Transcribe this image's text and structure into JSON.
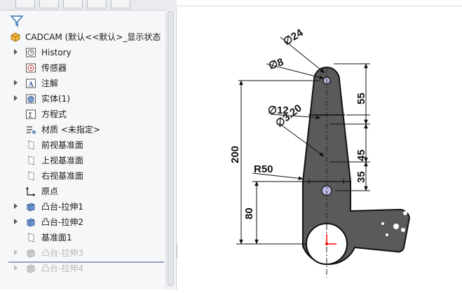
{
  "tree": {
    "root": {
      "label": "CADCAM  (默认<<默认>_显示状态",
      "icon": "part-icon"
    },
    "items": [
      {
        "label": "History",
        "icon": "history-icon",
        "expandable": true,
        "dim": false
      },
      {
        "label": "传感器",
        "icon": "sensor-icon",
        "expandable": false,
        "dim": false
      },
      {
        "label": "注解",
        "icon": "annotation-icon",
        "expandable": true,
        "dim": false
      },
      {
        "label": "实体(1)",
        "icon": "solid-body-icon",
        "expandable": true,
        "dim": false
      },
      {
        "label": "方程式",
        "icon": "equation-icon",
        "expandable": false,
        "dim": false
      },
      {
        "label": "材质 <未指定>",
        "icon": "material-icon",
        "expandable": false,
        "dim": false
      },
      {
        "label": "前视基准面",
        "icon": "plane-icon",
        "expandable": false,
        "dim": false
      },
      {
        "label": "上视基准面",
        "icon": "plane-icon",
        "expandable": false,
        "dim": false
      },
      {
        "label": "右视基准面",
        "icon": "plane-icon",
        "expandable": false,
        "dim": false
      },
      {
        "label": "原点",
        "icon": "origin-icon",
        "expandable": false,
        "dim": false
      },
      {
        "label": "凸台-拉伸1",
        "icon": "extrude-icon",
        "expandable": true,
        "dim": false
      },
      {
        "label": "凸台-拉伸2",
        "icon": "extrude-icon",
        "expandable": true,
        "dim": false
      },
      {
        "label": "基准面1",
        "icon": "plane-icon",
        "expandable": false,
        "dim": false
      },
      {
        "label": "凸台-拉伸3",
        "icon": "extrude-icon",
        "expandable": true,
        "dim": true
      },
      {
        "label": "凸台-拉伸4",
        "icon": "extrude-icon",
        "expandable": true,
        "dim": true
      }
    ]
  },
  "drawing": {
    "dimensions": {
      "d24": "∅24",
      "d8": "∅8",
      "d12": "∅12",
      "d320": "∅3.20",
      "r50": "R50",
      "v200": "200",
      "v80": "80",
      "v55": "55",
      "v45": "45",
      "v35": "35"
    },
    "colors": {
      "body": "#5a5a5a",
      "outline": "#111111",
      "hole": "#b8b8e0",
      "accent": "#ff0000"
    }
  }
}
